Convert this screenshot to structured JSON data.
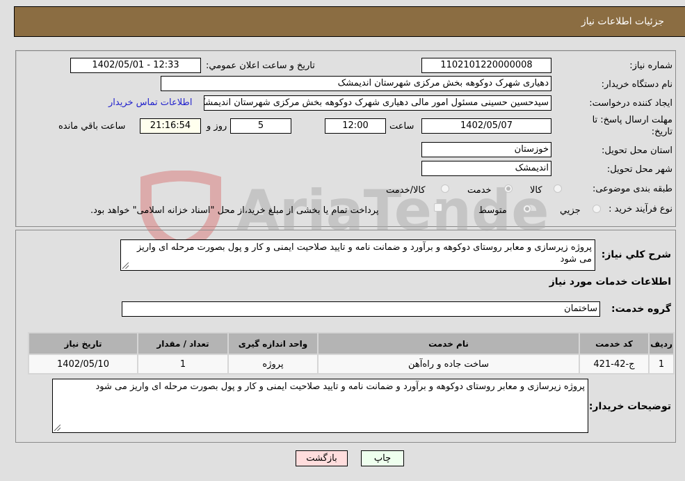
{
  "header": {
    "title": "جزئیات اطلاعات نیاز"
  },
  "form": {
    "need_number": {
      "label": "شماره نیاز:",
      "value": "1102101220000008"
    },
    "announce_datetime": {
      "label": "تاريخ و ساعت اعلان عمومي:",
      "value": "1402/05/01 - 12:33"
    },
    "buyer_org": {
      "label": "نام دستگاه خريدار:",
      "value": "دهیاری شهرک دوکوهه بخش مرکزی شهرستان اندیمشک"
    },
    "requester": {
      "label": "ايجاد کننده درخواست:",
      "value": "سیدحسین حسینی مسئول امور مالی دهیاری شهرک دوکوهه بخش مرکزی شهرستان اندیمشک"
    },
    "buyer_contact_link": "اطلاعات تماس خريدار",
    "deadline": {
      "label_line1": "مهلت ارسال پاسخ: تا",
      "label_line2": "تاريخ:",
      "date": "1402/05/07",
      "time_label": "ساعت",
      "time": "12:00",
      "days": "5",
      "days_label": "روز و",
      "remaining": "21:16:54",
      "remaining_label": "ساعت باقي مانده"
    },
    "province": {
      "label": "استان محل تحويل:",
      "value": "خوزستان"
    },
    "city": {
      "label": "شهر محل تحويل:",
      "value": "اندیمشک"
    },
    "category": {
      "label": "طبقه بندی موضوعی:",
      "options": [
        "کالا",
        "خدمت",
        "کالا/خدمت"
      ],
      "selected": "خدمت"
    },
    "purchase_type": {
      "label": "نوع فرآيند خريد :",
      "options": [
        "جزيي",
        "متوسط"
      ],
      "selected": "متوسط",
      "treasury_checkbox_label": "پرداخت تمام يا بخشی از مبلغ خريد،از محل \"اسناد خزانه اسلامی\" خواهد بود.",
      "treasury_checked": false
    }
  },
  "description": {
    "label": "شرح کلي نياز:",
    "value": "پروژه زیرسازی و معابر روستای دوکوهه و برآورد و ضمانت نامه و تایید صلاحیت ایمنی و کار و پول بصورت مرحله ای واریز می شود"
  },
  "services": {
    "section_title": "اطلاعات خدمات مورد نياز",
    "group_label": "گروه خدمت:",
    "group_value": "ساختمان",
    "table": {
      "headers": [
        "رديف",
        "کد خدمت",
        "نام خدمت",
        "واحد اندازه گيری",
        "تعداد / مقدار",
        "تاريخ نياز"
      ],
      "rows": [
        [
          "1",
          "ج-42-421",
          "ساخت جاده و راه‌آهن",
          "پروژه",
          "1",
          "1402/05/10"
        ]
      ]
    }
  },
  "buyer_notes": {
    "label": "توضيحات خريدار:",
    "value": "پروژه زیرسازی و معابر روستای دوکوهه و برآورد و ضمانت نامه و تایید صلاحیت ایمنی و کار و پول بصورت مرحله ای واریز می شود"
  },
  "buttons": {
    "print": "چاپ",
    "back": "بازگشت"
  },
  "watermark": {
    "text": "AriaTender.neT"
  },
  "colors": {
    "header_bg": "#8b6d42",
    "print_bg": "#eeffee",
    "back_bg": "#ffdddd",
    "link": "#2222cc"
  }
}
